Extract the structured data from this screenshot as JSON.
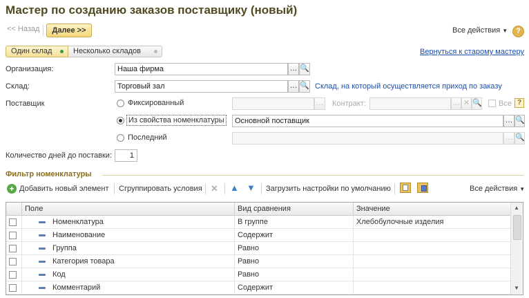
{
  "window": {
    "title": "Мастер по созданию заказов поставщику (новый)"
  },
  "nav": {
    "back_label": "<< Назад",
    "next_label": "Далее >>",
    "all_actions": "Все действия",
    "help": "?"
  },
  "mode": {
    "single_label": "Один склад",
    "multi_label": "Несколько складов",
    "old_wizard_link": "Вернуться к старому мастеру"
  },
  "form": {
    "org_label": "Организация:",
    "org_value": "Наша фирма",
    "warehouse_label": "Склад:",
    "warehouse_value": "Торговый зал",
    "warehouse_hint": "Склад, на который осуществляется приход по заказу",
    "supplier_label": "Поставщик",
    "fixed_label": "Фиксированный",
    "contract_label": "Контракт:",
    "all_label": "Все",
    "from_item_label": "Из свойства номенклатуры",
    "from_item_value": "Основной поставщик",
    "last_label": "Последний",
    "days_label": "Количество дней до поставки:",
    "days_value": "1",
    "selected_supplier_mode": "Из свойства номенклатуры"
  },
  "filter": {
    "title": "Фильтр номенклатуры",
    "add_label": "Добавить новый элемент",
    "group_label": "Сгруппировать условия",
    "load_defaults_label": "Загрузить настройки по умолчанию",
    "all_actions": "Все действия",
    "columns": [
      "Поле",
      "Вид сравнения",
      "Значение"
    ],
    "rows": [
      {
        "field": "Номенклатура",
        "comparison": "В группе",
        "value": "Хлебобулочные изделия"
      },
      {
        "field": "Наименование",
        "comparison": "Содержит",
        "value": ""
      },
      {
        "field": "Группа",
        "comparison": "Равно",
        "value": ""
      },
      {
        "field": "Категория товара",
        "comparison": "Равно",
        "value": ""
      },
      {
        "field": "Код",
        "comparison": "Равно",
        "value": ""
      },
      {
        "field": "Комментарий",
        "comparison": "Содержит",
        "value": ""
      }
    ]
  },
  "colors": {
    "accent": "#e2b64d",
    "link": "#1d4ea8",
    "title": "#4f4a22"
  }
}
